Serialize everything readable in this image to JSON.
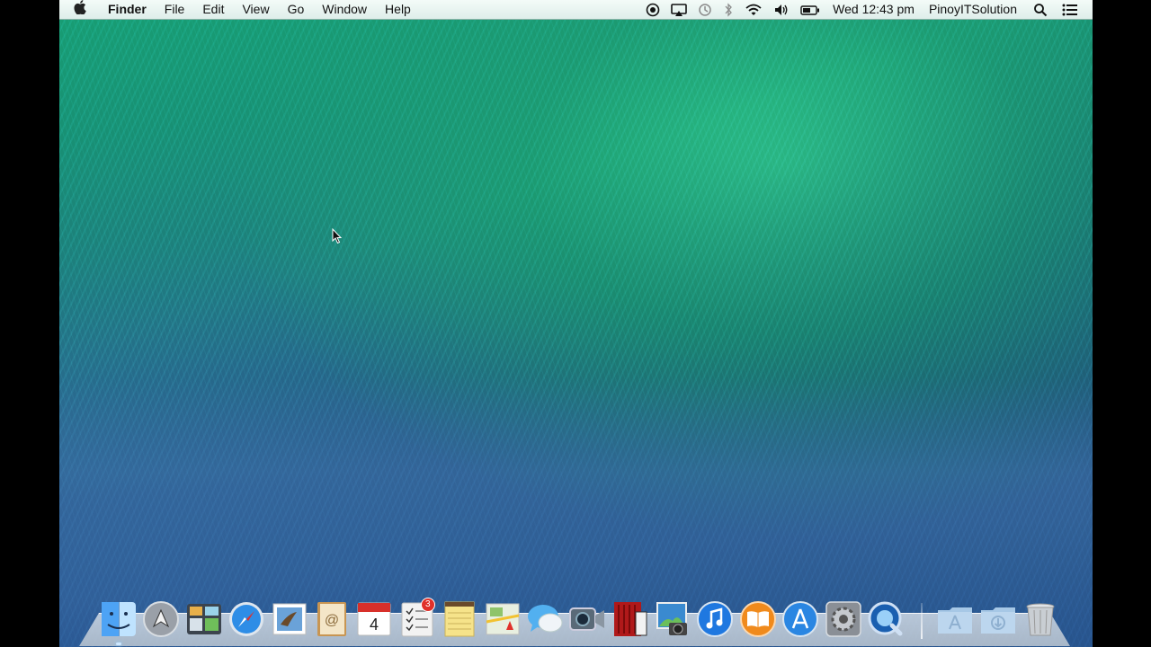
{
  "menubar": {
    "apple_glyph": "",
    "app_name": "Finder",
    "menus": [
      "File",
      "Edit",
      "View",
      "Go",
      "Window",
      "Help"
    ],
    "clock": "Wed 12:43 pm",
    "user": "PinoyITSolution",
    "status_icons": [
      "record-icon",
      "airplay-icon",
      "time-machine-icon",
      "bluetooth-icon",
      "wifi-icon",
      "volume-icon",
      "battery-icon",
      "spotlight-icon",
      "notification-center-icon"
    ]
  },
  "dock": {
    "apps": [
      {
        "name": "finder-icon",
        "color": "#4da3f5",
        "running": true
      },
      {
        "name": "launchpad-icon",
        "color": "#9aa0a8"
      },
      {
        "name": "mission-control-icon",
        "color": "#5a6470"
      },
      {
        "name": "safari-icon",
        "color": "#2e8de6"
      },
      {
        "name": "mail-icon",
        "color": "#6aa2d8"
      },
      {
        "name": "contacts-icon",
        "color": "#c89552"
      },
      {
        "name": "calendar-icon",
        "color": "#ffffff",
        "label": "4"
      },
      {
        "name": "reminders-icon",
        "color": "#f2f2f2",
        "badge": "3"
      },
      {
        "name": "notes-icon",
        "color": "#f6e38a"
      },
      {
        "name": "maps-icon",
        "color": "#8fc46a"
      },
      {
        "name": "messages-icon",
        "color": "#52b0f0"
      },
      {
        "name": "facetime-icon",
        "color": "#5a6a78"
      },
      {
        "name": "photo-booth-icon",
        "color": "#b0191a"
      },
      {
        "name": "iphoto-icon",
        "color": "#3a8ad0"
      },
      {
        "name": "itunes-icon",
        "color": "#1f78e0"
      },
      {
        "name": "ibooks-icon",
        "color": "#f08a1c"
      },
      {
        "name": "app-store-icon",
        "color": "#2a86e2"
      },
      {
        "name": "system-preferences-icon",
        "color": "#8a8f96"
      },
      {
        "name": "quicktime-icon",
        "color": "#1a5fb0"
      }
    ],
    "stacks": [
      {
        "name": "applications-folder-icon",
        "color": "#a7c8e6"
      },
      {
        "name": "downloads-folder-icon",
        "color": "#a7c8e6"
      }
    ],
    "trash": {
      "name": "trash-icon",
      "color": "#c9ced3"
    }
  }
}
